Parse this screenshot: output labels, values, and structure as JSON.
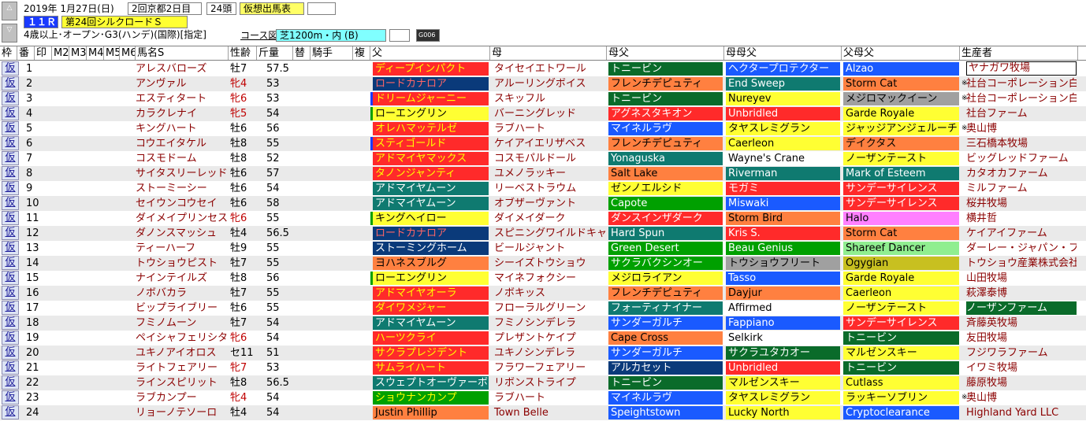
{
  "header": {
    "date": "2019年 1月27日(日)",
    "meeting": "2回京都2日目",
    "runners": "24頭",
    "mode": "仮想出馬表",
    "race_no": "１１Ｒ",
    "race_name": "第24回シルクロードＳ",
    "conditions": "4歳以上･オープン･G3(ハンデ)(国際)[指定]",
    "course_label": "コース図",
    "course": "芝1200m・内 (B)",
    "grade_badge": "G006",
    "nav_up": "△",
    "nav_down": "▽"
  },
  "colors": {
    "dark_green": "#0a6b2a",
    "teal": "#0f7a70",
    "navy": "#0a3a7a",
    "red": "#ff2a2a",
    "yellow": "#ffff33",
    "orange": "#ff8040",
    "pink": "#ff80ff",
    "olive": "#c8c020",
    "light_green": "#90ee90",
    "green": "#00a000",
    "blue": "#1a5aff",
    "sky": "#00bfff",
    "gray": "#a0a0a0",
    "peach": "#ffcc99"
  },
  "columns": [
    "枠",
    "番",
    "印",
    "M2",
    "M3",
    "M4",
    "M5",
    "M6",
    "馬名S",
    "性齢",
    "斤量",
    "替",
    "騎手",
    "複",
    "父",
    "母",
    "母父",
    "母母父",
    "父母父",
    "生産者"
  ],
  "rows": [
    {
      "waku": "仮",
      "no": "1",
      "name": "アレスバローズ",
      "sex": "牡7",
      "weight": "57.5",
      "sire": "ディープインパクト",
      "sire_bg": "#ff2a2a",
      "sire_fg": "#ffff00",
      "sire_flag": "",
      "dam": "タイセイエトワール",
      "bms": "トニービン",
      "bms_bg": "#0a6b2a",
      "bms_fg": "#ffffff",
      "bbms": "ヘクタープロテクター",
      "bbms_bg": "#1a5aff",
      "bbms_fg": "#ffffff",
      "sbms": "Alzao",
      "sbms_bg": "#1a5aff",
      "sbms_fg": "#ffffff",
      "breeder": "ヤナガワ牧場",
      "mark": ""
    },
    {
      "waku": "仮",
      "no": "2",
      "name": "アンヴァル",
      "sex": "牝4",
      "weight": "53",
      "sire": "ロードカナロア",
      "sire_bg": "#0a3a7a",
      "sire_fg": "#ff6666",
      "sire_flag": "",
      "dam": "アルーリングボイス",
      "bms": "フレンチデピュティ",
      "bms_bg": "#ff8040",
      "bms_fg": "#000000",
      "bbms": "End Sweep",
      "bbms_bg": "#0f7a70",
      "bbms_fg": "#ffffff",
      "sbms": "Storm Cat",
      "sbms_bg": "#ff8040",
      "sbms_fg": "#000000",
      "breeder": "社台コーポレーション白",
      "mark": "※"
    },
    {
      "waku": "仮",
      "no": "3",
      "name": "エスティタート",
      "sex": "牝6",
      "weight": "53",
      "sire": "ドリームジャーニー",
      "sire_bg": "#ff2a2a",
      "sire_fg": "#ffff00",
      "sire_flag": "#1a3aff",
      "dam": "スキッフル",
      "bms": "トニービン",
      "bms_bg": "#0a6b2a",
      "bms_fg": "#ffffff",
      "bbms": "Nureyev",
      "bbms_bg": "#ffff33",
      "bbms_fg": "#000000",
      "sbms": "メジロマックイーン",
      "sbms_bg": "#a0a0a0",
      "sbms_fg": "#000000",
      "breeder": "社台コーポレーション白",
      "mark": "※"
    },
    {
      "waku": "仮",
      "no": "4",
      "name": "カラクレナイ",
      "sex": "牝5",
      "weight": "54",
      "sire": "ローエングリン",
      "sire_bg": "#ffff33",
      "sire_fg": "#000000",
      "sire_flag": "#00a000",
      "dam": "バーニングレッド",
      "bms": "アグネスタキオン",
      "bms_bg": "#ff2a2a",
      "bms_fg": "#ffffff",
      "bbms": "Unbridled",
      "bbms_bg": "#ff2a2a",
      "bbms_fg": "#ffffff",
      "sbms": "Garde Royale",
      "sbms_bg": "#ffff33",
      "sbms_fg": "#000000",
      "breeder": "社台ファーム",
      "mark": ""
    },
    {
      "waku": "仮",
      "no": "5",
      "name": "キングハート",
      "sex": "牡6",
      "weight": "56",
      "sire": "オレハマッテルゼ",
      "sire_bg": "#ff2a2a",
      "sire_fg": "#ffff00",
      "sire_flag": "",
      "dam": "ラブハート",
      "bms": "マイネルラヴ",
      "bms_bg": "#1a5aff",
      "bms_fg": "#ffffff",
      "bbms": "タヤスレミグラン",
      "bbms_bg": "#ffff33",
      "bbms_fg": "#000000",
      "sbms": "ジャッジアンジェルーチ",
      "sbms_bg": "#ffff33",
      "sbms_fg": "#000000",
      "breeder": "奥山博",
      "mark": "※"
    },
    {
      "waku": "仮",
      "no": "6",
      "name": "コウエイタケル",
      "sex": "牡8",
      "weight": "55",
      "sire": "スティゴールド",
      "sire_bg": "#ff2a2a",
      "sire_fg": "#ffff00",
      "sire_flag": "#1a3aff",
      "dam": "ケイアイエリザベス",
      "bms": "フレンチデピュティ",
      "bms_bg": "#ff8040",
      "bms_fg": "#000000",
      "bbms": "Caerleon",
      "bbms_bg": "#ffff33",
      "bbms_fg": "#000000",
      "sbms": "デイクタス",
      "sbms_bg": "#ff8040",
      "sbms_fg": "#000000",
      "breeder": "三石橋本牧場",
      "mark": ""
    },
    {
      "waku": "仮",
      "no": "7",
      "name": "コスモドーム",
      "sex": "牡8",
      "weight": "52",
      "sire": "アドマイヤマックス",
      "sire_bg": "#ff2a2a",
      "sire_fg": "#ffff00",
      "sire_flag": "",
      "dam": "コスモパルドール",
      "bms": "Yonaguska",
      "bms_bg": "#0f7a70",
      "bms_fg": "#ffffff",
      "bbms": "Wayne's Crane",
      "bbms_bg": "#ffffff",
      "bbms_fg": "#000000",
      "sbms": "ノーザンテースト",
      "sbms_bg": "#ffff33",
      "sbms_fg": "#000000",
      "breeder": "ビッグレッドファーム",
      "mark": ""
    },
    {
      "waku": "仮",
      "no": "8",
      "name": "サイタスリーレッド",
      "sex": "牡6",
      "weight": "57",
      "sire": "タノンジャンティ",
      "sire_bg": "#ff2a2a",
      "sire_fg": "#ffff00",
      "sire_flag": "",
      "dam": "ユメノラッキー",
      "bms": "Salt Lake",
      "bms_bg": "#ff8040",
      "bms_fg": "#000000",
      "bbms": "Riverman",
      "bbms_bg": "#0f7a70",
      "bbms_fg": "#ffffff",
      "sbms": "Mark of Esteem",
      "sbms_bg": "#0f7a70",
      "sbms_fg": "#ffffff",
      "breeder": "カタオカファーム",
      "mark": ""
    },
    {
      "waku": "仮",
      "no": "9",
      "name": "ストーミーシー",
      "sex": "牡6",
      "weight": "54",
      "sire": "アドマイヤムーン",
      "sire_bg": "#0f7a70",
      "sire_fg": "#ffffff",
      "sire_flag": "",
      "dam": "リーベストラウム",
      "bms": "ゼンノエルシド",
      "bms_bg": "#ffff33",
      "bms_fg": "#000000",
      "bbms": "モガミ",
      "bbms_bg": "#ff2a2a",
      "bbms_fg": "#ffffff",
      "sbms": "サンデーサイレンス",
      "sbms_bg": "#ff2a2a",
      "sbms_fg": "#ffffff",
      "breeder": "ミルファーム",
      "mark": ""
    },
    {
      "waku": "仮",
      "no": "10",
      "name": "セイウンコウセイ",
      "sex": "牡6",
      "weight": "58",
      "sire": "アドマイヤムーン",
      "sire_bg": "#0f7a70",
      "sire_fg": "#ffffff",
      "sire_flag": "",
      "dam": "オブザーヴァント",
      "bms": "Capote",
      "bms_bg": "#00a000",
      "bms_fg": "#ffffff",
      "bbms": "Miswaki",
      "bbms_bg": "#1a5aff",
      "bbms_fg": "#ffffff",
      "sbms": "サンデーサイレンス",
      "sbms_bg": "#ff2a2a",
      "sbms_fg": "#ffffff",
      "breeder": "桜井牧場",
      "mark": ""
    },
    {
      "waku": "仮",
      "no": "11",
      "name": "ダイメイプリンセス",
      "sex": "牝6",
      "weight": "55",
      "sire": "キングヘイロー",
      "sire_bg": "#ffff33",
      "sire_fg": "#000000",
      "sire_flag": "#00a000",
      "dam": "ダイメイダーク",
      "bms": "ダンスインザダーク",
      "bms_bg": "#ff2a2a",
      "bms_fg": "#ffffff",
      "bbms": "Storm Bird",
      "bbms_bg": "#ff8040",
      "bbms_fg": "#000000",
      "sbms": "Halo",
      "sbms_bg": "#ff80ff",
      "sbms_fg": "#000000",
      "breeder": "横井哲",
      "mark": ""
    },
    {
      "waku": "仮",
      "no": "12",
      "name": "ダノンスマッシュ",
      "sex": "牡4",
      "weight": "56.5",
      "sire": "ロードカナロア",
      "sire_bg": "#0a3a7a",
      "sire_fg": "#ff6666",
      "sire_flag": "",
      "dam": "スピニングワイルドキャット",
      "bms": "Hard Spun",
      "bms_bg": "#0f7a70",
      "bms_fg": "#ffffff",
      "bbms": "Kris S.",
      "bbms_bg": "#ff2a2a",
      "bbms_fg": "#ffffff",
      "sbms": "Storm Cat",
      "sbms_bg": "#ff8040",
      "sbms_fg": "#000000",
      "breeder": "ケイアイファーム",
      "mark": ""
    },
    {
      "waku": "仮",
      "no": "13",
      "name": "ティーハーフ",
      "sex": "牡9",
      "weight": "55",
      "sire": "ストーミングホーム",
      "sire_bg": "#0a3a7a",
      "sire_fg": "#ffffff",
      "sire_flag": "",
      "dam": "ビールジャント",
      "bms": "Green Desert",
      "bms_bg": "#00a000",
      "bms_fg": "#ffffff",
      "bbms": "Beau Genius",
      "bbms_bg": "#00a000",
      "bbms_fg": "#ffffff",
      "sbms": "Shareef Dancer",
      "sbms_bg": "#90ee90",
      "sbms_fg": "#000000",
      "breeder": "ダーレー・ジャパン・ファーム",
      "mark": ""
    },
    {
      "waku": "仮",
      "no": "14",
      "name": "トウショウピスト",
      "sex": "牡7",
      "weight": "55",
      "sire": "ヨハネスブルグ",
      "sire_bg": "#ff8040",
      "sire_fg": "#000000",
      "sire_flag": "",
      "dam": "シーイズトウショウ",
      "bms": "サクラバクシンオー",
      "bms_bg": "#00a000",
      "bms_fg": "#ffffff",
      "bbms": "トウショウフリート",
      "bbms_bg": "#a0a0a0",
      "bbms_fg": "#000000",
      "sbms": "Ogygian",
      "sbms_bg": "#c8c020",
      "sbms_fg": "#000000",
      "breeder": "トウショウ産業株式会社",
      "mark": ""
    },
    {
      "waku": "仮",
      "no": "15",
      "name": "ナインテイルズ",
      "sex": "牡8",
      "weight": "56",
      "sire": "ローエングリン",
      "sire_bg": "#ffff33",
      "sire_fg": "#000000",
      "sire_flag": "#00a000",
      "dam": "マイネフォクシー",
      "bms": "メジロライアン",
      "bms_bg": "#ffff33",
      "bms_fg": "#000000",
      "bbms": "Tasso",
      "bbms_bg": "#1a5aff",
      "bbms_fg": "#ffffff",
      "sbms": "Garde Royale",
      "sbms_bg": "#ffff33",
      "sbms_fg": "#000000",
      "breeder": "山田牧場",
      "mark": ""
    },
    {
      "waku": "仮",
      "no": "16",
      "name": "ノボバカラ",
      "sex": "牡7",
      "weight": "55",
      "sire": "アドマイヤオーラ",
      "sire_bg": "#ff2a2a",
      "sire_fg": "#ffff00",
      "sire_flag": "",
      "dam": "ノボキッス",
      "bms": "フレンチデピュティ",
      "bms_bg": "#ff8040",
      "bms_fg": "#000000",
      "bbms": "Dayjur",
      "bbms_bg": "#ff8040",
      "bbms_fg": "#000000",
      "sbms": "Caerleon",
      "sbms_bg": "#ffff33",
      "sbms_fg": "#000000",
      "breeder": "萩澤泰博",
      "mark": ""
    },
    {
      "waku": "仮",
      "no": "17",
      "name": "ビップライブリー",
      "sex": "牡6",
      "weight": "55",
      "sire": "ダイワメジャー",
      "sire_bg": "#ff2a2a",
      "sire_fg": "#ffff00",
      "sire_flag": "",
      "dam": "フローラルグリーン",
      "bms": "フォーティナイナー",
      "bms_bg": "#0f7a70",
      "bms_fg": "#ffffff",
      "bbms": "Affirmed",
      "bbms_bg": "#ffffff",
      "bbms_fg": "#000000",
      "sbms": "ノーザンテースト",
      "sbms_bg": "#ffff33",
      "sbms_fg": "#000000",
      "breeder": "ノーザンファーム",
      "mark": "",
      "breeder_bg": "#0a6b2a",
      "breeder_fg": "#ffffff"
    },
    {
      "waku": "仮",
      "no": "18",
      "name": "フミノムーン",
      "sex": "牡7",
      "weight": "54",
      "sire": "アドマイヤムーン",
      "sire_bg": "#0f7a70",
      "sire_fg": "#ffffff",
      "sire_flag": "",
      "dam": "フミノシンデレラ",
      "bms": "サンダーガルチ",
      "bms_bg": "#1a5aff",
      "bms_fg": "#ffffff",
      "bbms": "Fappiano",
      "bbms_bg": "#1a5aff",
      "bbms_fg": "#ffffff",
      "sbms": "サンデーサイレンス",
      "sbms_bg": "#ff2a2a",
      "sbms_fg": "#ffffff",
      "breeder": "斉藤英牧場",
      "mark": ""
    },
    {
      "waku": "仮",
      "no": "19",
      "name": "ペイシャフェリシタ",
      "sex": "牝6",
      "weight": "54",
      "sire": "ハーツクライ",
      "sire_bg": "#ff2a2a",
      "sire_fg": "#ffff00",
      "sire_flag": "",
      "dam": "プレザントケイプ",
      "bms": "Cape Cross",
      "bms_bg": "#ff8040",
      "bms_fg": "#000000",
      "bbms": "Selkirk",
      "bbms_bg": "#ffffff",
      "bbms_fg": "#000000",
      "sbms": "トニービン",
      "sbms_bg": "#0a6b2a",
      "sbms_fg": "#ffffff",
      "breeder": "友田牧場",
      "mark": ""
    },
    {
      "waku": "仮",
      "no": "20",
      "name": "ユキノアイオロス",
      "sex": "セ11",
      "weight": "51",
      "sire": "サクラプレジデント",
      "sire_bg": "#ff2a2a",
      "sire_fg": "#ffff00",
      "sire_flag": "",
      "dam": "ユキノシンデレラ",
      "bms": "サンダーガルチ",
      "bms_bg": "#1a5aff",
      "bms_fg": "#ffffff",
      "bbms": "サクラユタカオー",
      "bbms_bg": "#0a6b2a",
      "bbms_fg": "#ffffff",
      "sbms": "マルゼンスキー",
      "sbms_bg": "#ffff33",
      "sbms_fg": "#000000",
      "breeder": "フジワラファーム",
      "mark": ""
    },
    {
      "waku": "仮",
      "no": "21",
      "name": "ライトフェアリー",
      "sex": "牝7",
      "weight": "53",
      "sire": "サムライハート",
      "sire_bg": "#ff2a2a",
      "sire_fg": "#ffff00",
      "sire_flag": "",
      "dam": "フラワーフェアリー",
      "bms": "アルカセット",
      "bms_bg": "#0a3a7a",
      "bms_fg": "#ffffff",
      "bbms": "Unbridled",
      "bbms_bg": "#ff2a2a",
      "bbms_fg": "#ffffff",
      "sbms": "トニービン",
      "sbms_bg": "#0a6b2a",
      "sbms_fg": "#ffffff",
      "breeder": "イワミ牧場",
      "mark": ""
    },
    {
      "waku": "仮",
      "no": "22",
      "name": "ラインスピリット",
      "sex": "牡8",
      "weight": "56.5",
      "sire": "スウェプトオーヴァーボード",
      "sire_bg": "#0f7a70",
      "sire_fg": "#ffffff",
      "sire_flag": "",
      "dam": "リボンストライプ",
      "bms": "トニービン",
      "bms_bg": "#0a6b2a",
      "bms_fg": "#ffffff",
      "bbms": "マルゼンスキー",
      "bbms_bg": "#ffff33",
      "bbms_fg": "#000000",
      "sbms": "Cutlass",
      "sbms_bg": "#ffff33",
      "sbms_fg": "#000000",
      "breeder": "藤原牧場",
      "mark": ""
    },
    {
      "waku": "仮",
      "no": "23",
      "name": "ラブカンプー",
      "sex": "牝4",
      "weight": "54",
      "sire": "ショウナンカンプ",
      "sire_bg": "#00a000",
      "sire_fg": "#ffff00",
      "sire_flag": "",
      "dam": "ラブハート",
      "bms": "マイネルラヴ",
      "bms_bg": "#1a5aff",
      "bms_fg": "#ffffff",
      "bbms": "タヤスレミグラン",
      "bbms_bg": "#ffff33",
      "bbms_fg": "#000000",
      "sbms": "ラッキーソブリン",
      "sbms_bg": "#ffff33",
      "sbms_fg": "#000000",
      "breeder": "奥山博",
      "mark": "※"
    },
    {
      "waku": "仮",
      "no": "24",
      "name": "リョーノテソーロ",
      "sex": "牡4",
      "weight": "54",
      "sire": "Justin Phillip",
      "sire_bg": "#ff8040",
      "sire_fg": "#000000",
      "sire_flag": "",
      "dam": "Town Belle",
      "bms": "Speightstown",
      "bms_bg": "#1a5aff",
      "bms_fg": "#ffffff",
      "bbms": "Lucky North",
      "bbms_bg": "#ffff33",
      "bbms_fg": "#000000",
      "sbms": "Cryptoclearance",
      "sbms_bg": "#1a5aff",
      "sbms_fg": "#ffffff",
      "breeder": "Highland Yard LLC",
      "mark": ""
    }
  ]
}
